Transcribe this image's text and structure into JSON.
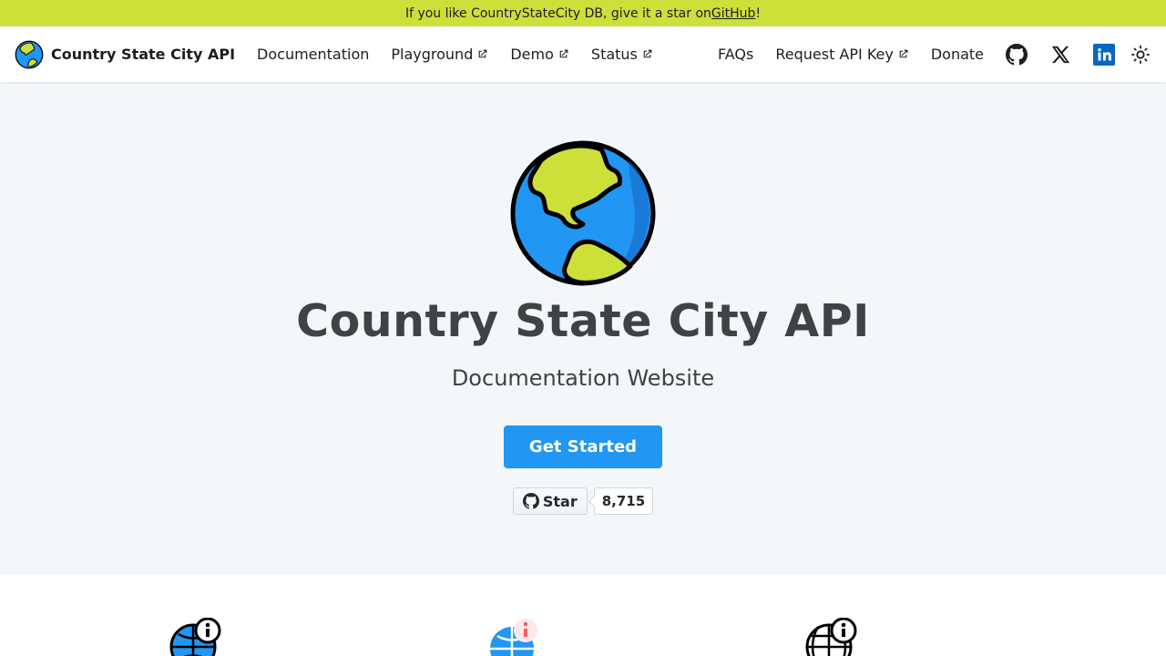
{
  "announcement": {
    "prefix": "If you like CountryStateCity DB, give it a star on ",
    "link": "GitHub",
    "suffix": "!"
  },
  "navbar": {
    "brand": "Country State City API",
    "left": [
      {
        "label": "Documentation",
        "external": false
      },
      {
        "label": "Playground",
        "external": true
      },
      {
        "label": "Demo",
        "external": true
      },
      {
        "label": "Status",
        "external": true
      }
    ],
    "right": [
      {
        "label": "FAQs",
        "external": false
      },
      {
        "label": "Request API Key",
        "external": true
      },
      {
        "label": "Donate",
        "external": false
      }
    ],
    "social_icons": [
      "github-icon",
      "x-icon",
      "linkedin-icon"
    ],
    "theme_icon": "sun-icon"
  },
  "hero": {
    "title": "Country State City API",
    "subtitle": "Documentation Website",
    "cta": "Get Started",
    "star_label": "Star",
    "star_count": "8,715"
  },
  "features": {
    "icons": [
      "globe-info-icon",
      "globe-info-color-icon",
      "globe-info-outline-icon"
    ]
  },
  "colors": {
    "accent": "#2196f3",
    "banner": "#cddf39",
    "hero_bg": "#f3f7f9",
    "globe_land": "#cddf39",
    "globe_ocean": "#2196f3"
  }
}
